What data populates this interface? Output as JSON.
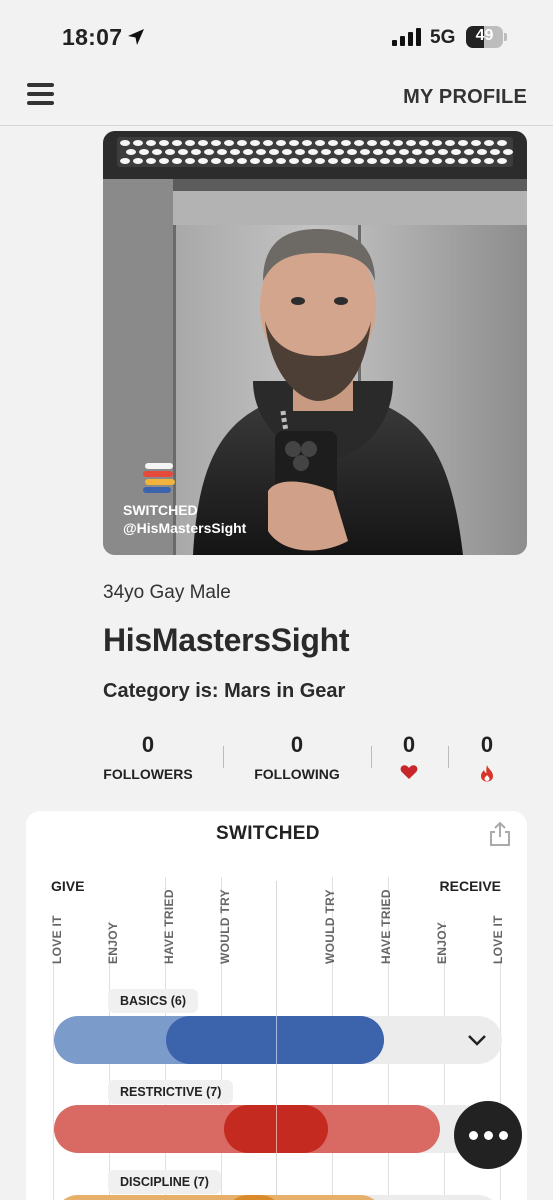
{
  "status_bar": {
    "time": "18:07",
    "network": "5G",
    "battery": "49",
    "battery_level": 0.49
  },
  "header": {
    "title": "MY PROFILE"
  },
  "profile": {
    "photo_badge_brand": "SWITCHED",
    "photo_handle": "@HisMastersSight",
    "meta": "34yo Gay Male",
    "username": "HisMastersSight",
    "category": "Category is: Mars in Gear"
  },
  "stats": {
    "followers_count": "0",
    "followers_label": "FOLLOWERS",
    "following_count": "0",
    "following_label": "FOLLOWING",
    "likes_count": "0",
    "likes_icon": "heart-icon",
    "fire_count": "0",
    "fire_icon": "flame-icon"
  },
  "kink_card": {
    "logo": "SWITCHED",
    "give_label": "GIVE",
    "receive_label": "RECEIVE",
    "scale_give": [
      "LOVE IT",
      "ENJOY",
      "HAVE TRIED",
      "WOULD TRY"
    ],
    "scale_receive": [
      "WOULD TRY",
      "HAVE TRIED",
      "ENJOY",
      "LOVE IT"
    ],
    "categories": [
      {
        "label": "BASICS (6)",
        "color_outer": "#7b9bcb",
        "color_inner": "#3b64ad"
      },
      {
        "label": "RESTRICTIVE (7)",
        "color_outer": "#d96a63",
        "color_inner": "#c42a1f"
      },
      {
        "label": "DISCIPLINE (7)",
        "color_outer": "#e7b06a",
        "color_inner": "#d98b2b"
      }
    ]
  },
  "colors": {
    "background": "#f2f2f2",
    "text": "#222222",
    "heart": "#c8262b",
    "flame": "#d8352a",
    "fab": "#222222"
  }
}
